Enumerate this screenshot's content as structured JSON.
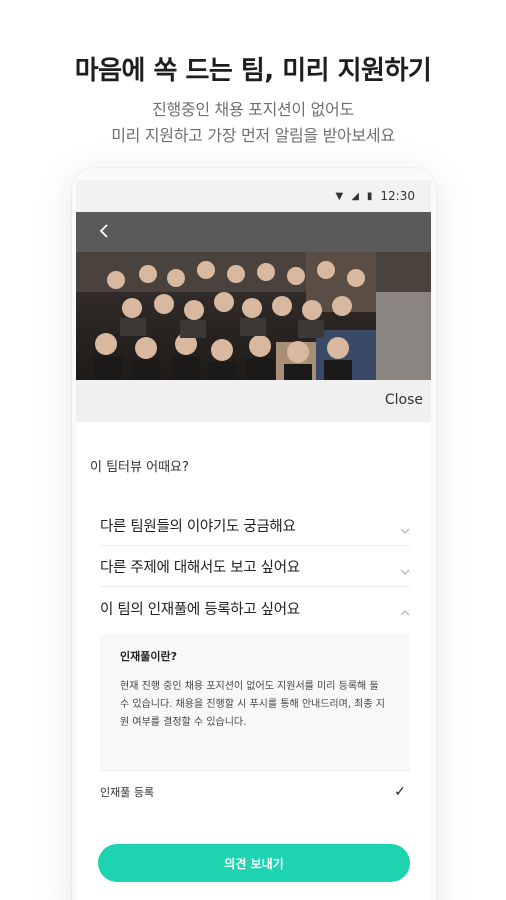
{
  "promo": {
    "title": "마음에 쏙 드는 팀, 미리 지원하기",
    "subtitle_line1": "진행중인 채용 포지션이 없어도",
    "subtitle_line2": "미리 지원하고 가장 먼저 알림을 받아보세요"
  },
  "status_bar": {
    "time": "12:30"
  },
  "header": {
    "back_icon": "chevron-left-icon"
  },
  "hero": {
    "image": "team-group-photo"
  },
  "close_label": "Close",
  "question": "이 팀터뷰 어때요?",
  "options": [
    {
      "label": "다른 팀원들의 이야기도 궁금해요",
      "expanded": false
    },
    {
      "label": "다른 주제에 대해서도 보고 싶어요",
      "expanded": false
    },
    {
      "label": "이 팀의 인재풀에 등록하고 싶어요",
      "expanded": true
    }
  ],
  "detail": {
    "title": "인재풀이란?",
    "body": "현재 진행 중인 채용 포지션이 없어도 지원서를 미리 등록해 둘 수 있습니다. 채용을 진행할 시 푸시를 통해 안내드리며, 최종 지원 여부를 결정할 수 있습니다."
  },
  "check_row": {
    "label": "인재풀 등록",
    "checked": true
  },
  "submit_label": "의견 보내기",
  "colors": {
    "accent": "#1dd3b0",
    "header": "#5a5a5a"
  }
}
